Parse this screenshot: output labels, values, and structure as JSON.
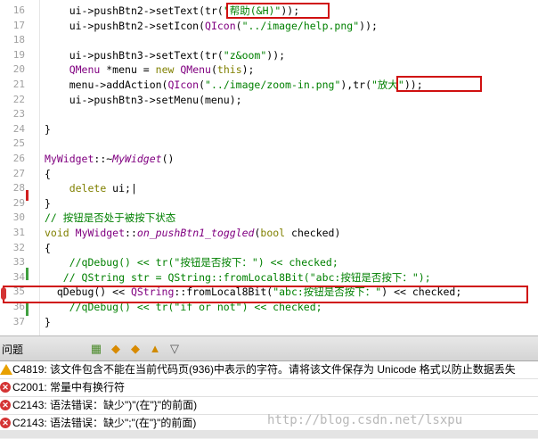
{
  "editor": {
    "lines": [
      {
        "n": "16",
        "html": "    <span class=\"tok-op\">ui-&gt;pushBtn2-&gt;setText(</span><span class=\"tok-op\">tr(</span><span class=\"tok-str\">\"帮助(&amp;H)\"</span><span class=\"tok-op\">));</span>"
      },
      {
        "n": "17",
        "html": "    ui-&gt;pushBtn2-&gt;setIcon(<span class=\"tok-ty\">QIcon</span>(<span class=\"tok-str\">\"../image/help.png\"</span>));"
      },
      {
        "n": "18",
        "html": ""
      },
      {
        "n": "19",
        "html": "    ui-&gt;pushBtn3-&gt;setText(tr(<span class=\"tok-str\">\"z&amp;oom\"</span>));"
      },
      {
        "n": "20",
        "html": "    <span class=\"tok-ty\">QMenu</span> *menu = <span class=\"tok-kw\">new</span> <span class=\"tok-ty\">QMenu</span>(<span class=\"tok-kw\">this</span>);"
      },
      {
        "n": "21",
        "html": "    menu-&gt;addAction(<span class=\"tok-ty\">QIcon</span>(<span class=\"tok-str\">\"../image/zoom-in.png\"</span>),tr(<span class=\"tok-str\">\"放大\"</span>));"
      },
      {
        "n": "22",
        "html": "    ui-&gt;pushBtn3-&gt;setMenu(menu);"
      },
      {
        "n": "23",
        "html": ""
      },
      {
        "n": "24",
        "html": "}"
      },
      {
        "n": "25",
        "html": ""
      },
      {
        "n": "26",
        "html": "<span class=\"tok-ty\">MyWidget</span>::~<span class=\"tok-it\">MyWidget</span>()"
      },
      {
        "n": "27",
        "html": "{"
      },
      {
        "n": "28",
        "html": "    <span class=\"tok-kw\">delete</span> ui;|"
      },
      {
        "n": "29",
        "html": "}"
      },
      {
        "n": "30",
        "html": "<span class=\"tok-cm\">// 按钮是否处于被按下状态</span>"
      },
      {
        "n": "31",
        "html": "<span class=\"tok-kw\">void</span> <span class=\"tok-ty\">MyWidget</span>::<span class=\"tok-it\">on_pushBtn1_toggled</span>(<span class=\"tok-kw\">bool</span> checked)"
      },
      {
        "n": "32",
        "html": "{"
      },
      {
        "n": "33",
        "html": "    <span class=\"tok-cm\">//qDebug() &lt;&lt; tr(\"按钮是否按下：\") &lt;&lt; checked;</span>"
      },
      {
        "n": "34",
        "html": "   <span class=\"tok-cm\">// QString str = QString::fromLocal8Bit(\"abc:按钮是否按下：\");</span>"
      },
      {
        "n": "35",
        "html": "  qDebug() &lt;&lt; <span class=\"tok-ty\">QString</span>::fromLocal8Bit(<span class=\"tok-str\">\"abc:按钮是否按下：\"</span>) &lt;&lt; checked;"
      },
      {
        "n": "36",
        "html": "    <span class=\"tok-cm\">//qDebug() &lt;&lt; tr(\"if or not\") &lt;&lt; checked;</span>"
      },
      {
        "n": "37",
        "html": "}"
      }
    ]
  },
  "panel": {
    "title": "问题",
    "issues": [
      {
        "type": "warning",
        "text": "C4819: 该文件包含不能在当前代码页(936)中表示的字符。请将该文件保存为 Unicode 格式以防止数据丢失"
      },
      {
        "type": "error",
        "text": "C2001: 常量中有换行符"
      },
      {
        "type": "error",
        "text": "C2143: 语法错误：缺少\")\"(在\"}\"的前面)"
      },
      {
        "type": "error",
        "text": "C2143: 语法错误：缺少\";\"(在\"}\"的前面)"
      }
    ]
  },
  "watermark": "http://blog.csdn.net/lsxpu",
  "colors": {
    "error": "#d43434",
    "warning": "#e8a000",
    "highlight_box": "#d01010"
  }
}
